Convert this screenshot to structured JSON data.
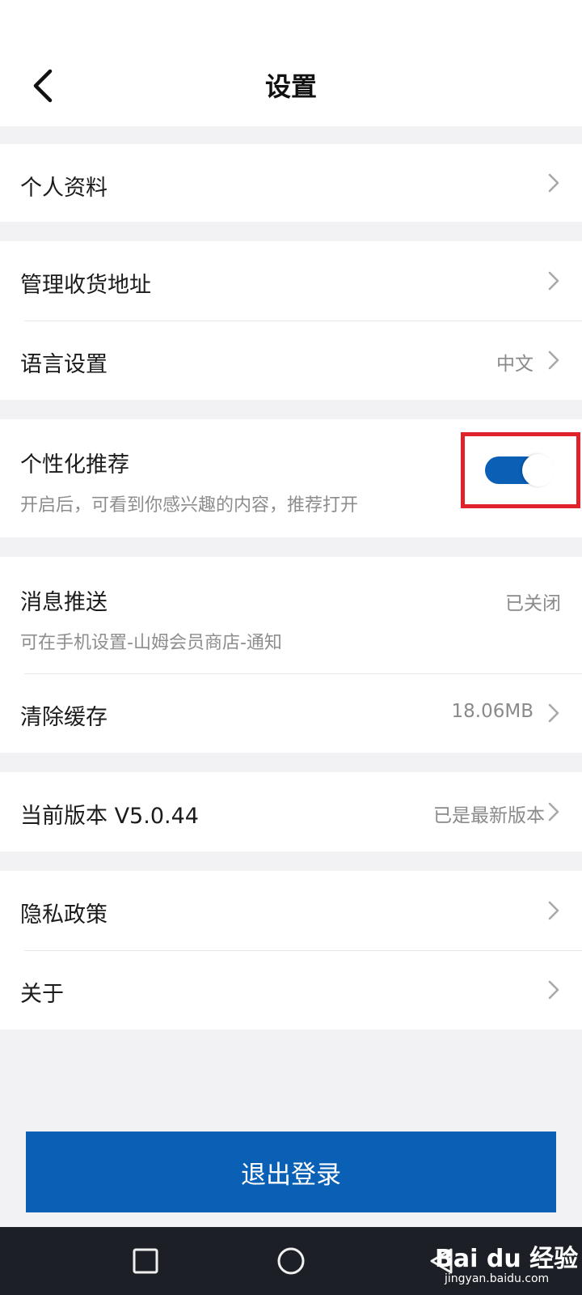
{
  "header": {
    "title": "设置"
  },
  "groups": {
    "profile": {
      "label": "个人资料"
    },
    "address": {
      "label": "管理收货地址"
    },
    "language": {
      "label": "语言设置",
      "value": "中文"
    },
    "personalized": {
      "label": "个性化推荐",
      "description": "开启后，可看到你感兴趣的内容，推荐打开",
      "enabled": true
    },
    "push": {
      "label": "消息推送",
      "description": "可在手机设置-山姆会员商店-通知",
      "value": "已关闭"
    },
    "cache": {
      "label": "清除缓存",
      "value": "18.06MB"
    },
    "version": {
      "label": "当前版本 V5.0.44",
      "value": "已是最新版本"
    },
    "privacy": {
      "label": "隐私政策"
    },
    "about": {
      "label": "关于"
    }
  },
  "logout": {
    "label": "退出登录"
  },
  "watermark": {
    "main": "Bai du 经验",
    "sub": "jingyan.baidu.com"
  },
  "colors": {
    "accent": "#0a60b4",
    "highlight": "#e0222a",
    "background": "#f2f2f4"
  }
}
